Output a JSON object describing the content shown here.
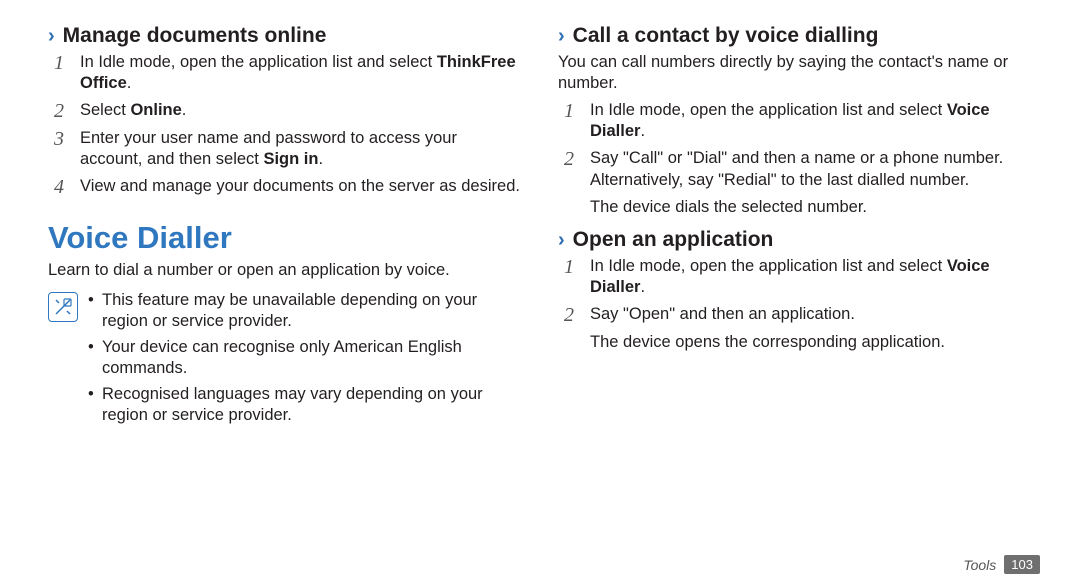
{
  "left": {
    "heading1": "Manage documents online",
    "steps1": [
      {
        "n": "1",
        "text": "In Idle mode, open the application list and select ",
        "bold": "ThinkFree Office",
        "after": "."
      },
      {
        "n": "2",
        "text": "Select ",
        "bold": "Online",
        "after": "."
      },
      {
        "n": "3",
        "text": "Enter your user name and password to access your account, and then select ",
        "bold": "Sign in",
        "after": "."
      },
      {
        "n": "4",
        "text": "View and manage your documents on the server as desired.",
        "bold": "",
        "after": ""
      }
    ],
    "title": "Voice Dialler",
    "intro": "Learn to dial a number or open an application by voice.",
    "notes": [
      "This feature may be unavailable depending on your region or service provider.",
      "Your device can recognise only American English commands.",
      "Recognised languages may vary depending on your region or service provider."
    ]
  },
  "right": {
    "heading1": "Call a contact by voice dialling",
    "para1": "You can call numbers directly by saying the contact's name or number.",
    "steps1": [
      {
        "n": "1",
        "text": "In Idle mode, open the application list and select ",
        "bold": "Voice Dialler",
        "after": "."
      },
      {
        "n": "2",
        "text": "Say \"Call\" or \"Dial\" and then a name or a phone number. Alternatively, say \"Redial\" to the last dialled number.",
        "bold": "",
        "after": ""
      }
    ],
    "result1": "The device dials the selected number.",
    "heading2": "Open an application",
    "steps2": [
      {
        "n": "1",
        "text": "In Idle mode, open the application list and select ",
        "bold": "Voice Dialler",
        "after": "."
      },
      {
        "n": "2",
        "text": "Say \"Open\" and then an application.",
        "bold": "",
        "after": ""
      }
    ],
    "result2": "The device opens the corresponding application."
  },
  "footer": {
    "section": "Tools",
    "page": "103"
  }
}
